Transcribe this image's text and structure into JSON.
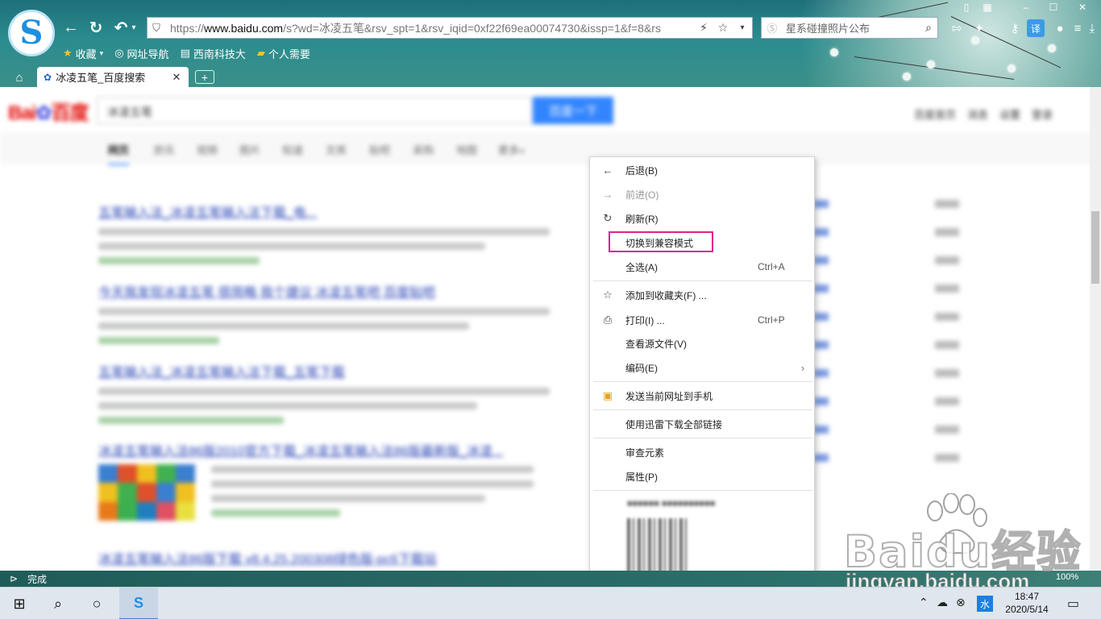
{
  "browser": {
    "address_url_prefix": "https://",
    "address_url_host": "www.baidu.com",
    "address_url_path": "/s?wd=冰凌五笔&rsv_spt=1&rsv_iqid=0xf22f69ea00074730&issp=1&f=8&rs",
    "search_placeholder": "星系碰撞照片公布",
    "favorites": [
      {
        "icon": "star-icon",
        "label": "收藏"
      },
      {
        "icon": "globe-icon",
        "label": "网址导航"
      },
      {
        "icon": "page-icon",
        "label": "西南科技大"
      },
      {
        "icon": "folder-icon",
        "label": "个人需要"
      }
    ],
    "tab_title": "冰凌五笔_百度搜索",
    "accent": "#2a8c8e"
  },
  "page": {
    "search_query": "冰凌五笔",
    "search_button": "百度一下",
    "top_links": [
      "百度首页",
      "消息",
      "设置",
      "登录"
    ],
    "nav_tabs": [
      "网页",
      "资讯",
      "视频",
      "图片",
      "知道",
      "文库",
      "贴吧",
      "采购",
      "地图",
      "更多»"
    ],
    "result_titles": [
      "五笔输入法_冰凌五笔输入法下载_电...",
      "今天我发现冰凌五笔 很简略 我个建议 冰凌五笔吧 百度贴吧",
      "五笔输入法_冰凌五笔输入法下载_五笔下载",
      "冰凌五笔输入法86版2010官方下载_冰凌五笔输入法86版最新版_冰凌...",
      "冰凌五笔输入法86版下载 v8.4.25.200308绿色版-pc6下载站"
    ]
  },
  "context_menu": {
    "items": [
      {
        "icon": "arrow-left-icon",
        "label": "后退(B)",
        "shortcut": "",
        "disabled": false
      },
      {
        "icon": "arrow-right-icon",
        "label": "前进(O)",
        "shortcut": "",
        "disabled": true
      },
      {
        "icon": "refresh-icon",
        "label": "刷新(R)",
        "shortcut": "",
        "disabled": false
      },
      {
        "icon": "",
        "label": "切换到兼容模式",
        "shortcut": "",
        "disabled": false
      },
      {
        "icon": "",
        "label": "全选(A)",
        "shortcut": "Ctrl+A",
        "disabled": false
      },
      {
        "icon": "star-outline-icon",
        "label": "添加到收藏夹(F) ...",
        "shortcut": "",
        "disabled": false
      },
      {
        "icon": "printer-icon",
        "label": "打印(I) ...",
        "shortcut": "Ctrl+P",
        "disabled": false
      },
      {
        "icon": "",
        "label": "查看源文件(V)",
        "shortcut": "",
        "disabled": false
      },
      {
        "icon": "",
        "label": "编码(E)",
        "shortcut": "",
        "disabled": false
      },
      {
        "icon": "phone-send-icon",
        "label": "发送当前网址到手机",
        "shortcut": "",
        "disabled": false
      },
      {
        "icon": "",
        "label": "使用迅雷下载全部链接",
        "shortcut": "",
        "disabled": false
      },
      {
        "icon": "",
        "label": "审查元素",
        "shortcut": "",
        "disabled": false
      },
      {
        "icon": "",
        "label": "属性(P)",
        "shortcut": "",
        "disabled": false
      }
    ],
    "highlight_color": "#e0218a"
  },
  "status_bar": {
    "text": "完成",
    "zoom": "100%"
  },
  "watermark": {
    "brand": "Baidu经验",
    "url": "jingyan.baidu.com"
  },
  "taskbar": {
    "ime_label": "水",
    "time": "18:47",
    "date": "2020/5/14"
  }
}
